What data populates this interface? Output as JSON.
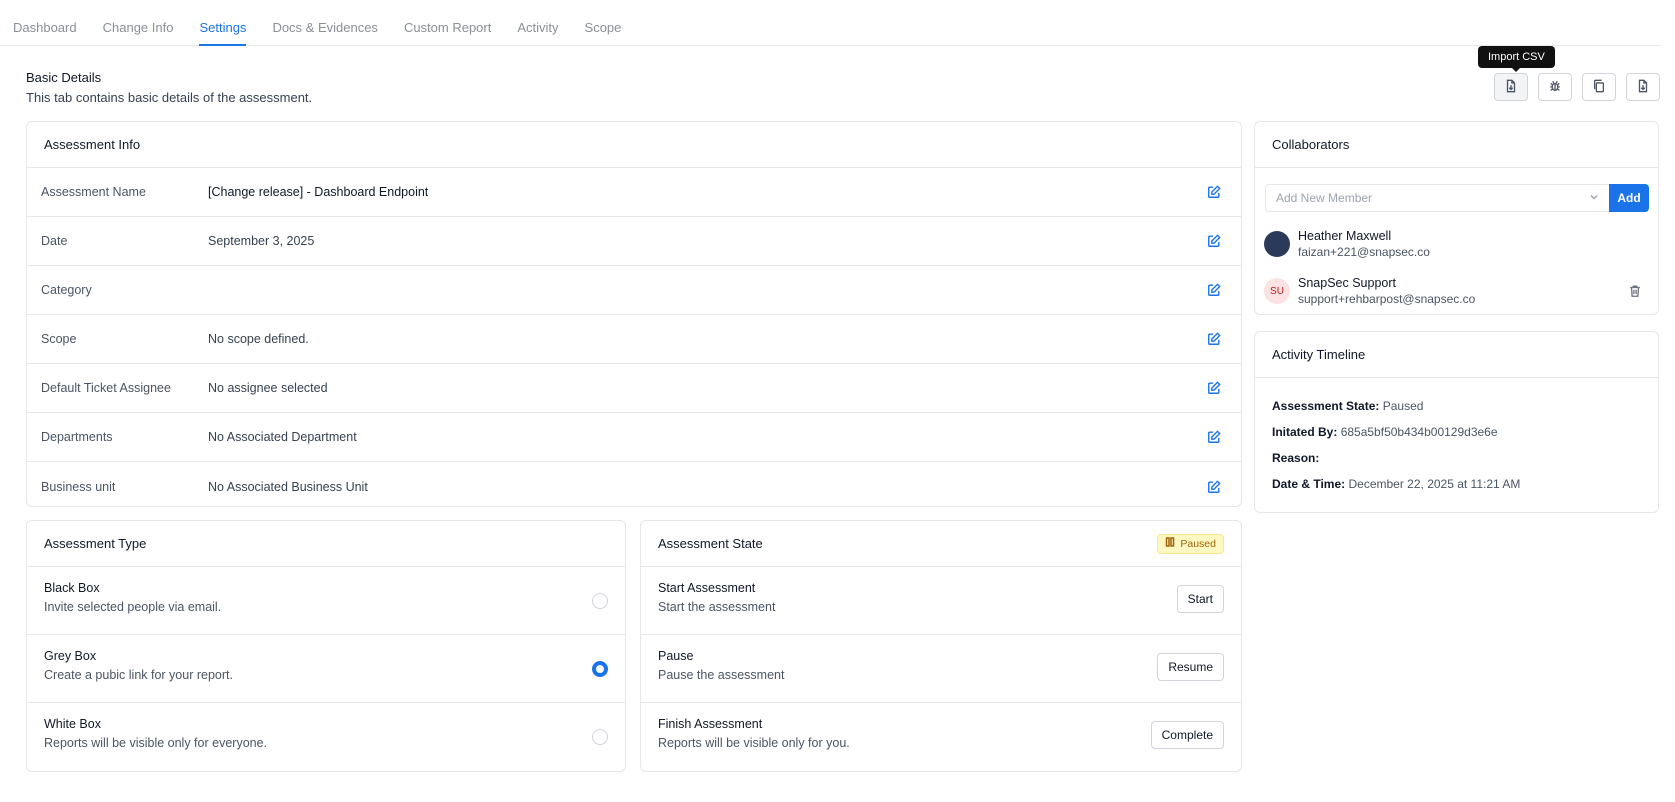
{
  "tabs": [
    {
      "label": "Dashboard",
      "active": false
    },
    {
      "label": "Change Info",
      "active": false
    },
    {
      "label": "Settings",
      "active": true
    },
    {
      "label": "Docs & Evidences",
      "active": false
    },
    {
      "label": "Custom Report",
      "active": false
    },
    {
      "label": "Activity",
      "active": false
    },
    {
      "label": "Scope",
      "active": false
    }
  ],
  "header": {
    "title": "Basic Details",
    "description": "This tab contains basic details of the assessment."
  },
  "tooltip": "Import CSV",
  "toolbar": {
    "icons": [
      "file-import-icon",
      "bug-icon",
      "copy-icon",
      "file-download-icon"
    ]
  },
  "assessment_info": {
    "title": "Assessment Info",
    "rows": [
      {
        "label": "Assessment Name",
        "value": "[Change release] - Dashboard Endpoint"
      },
      {
        "label": "Date",
        "value": "September 3, 2025"
      },
      {
        "label": "Category",
        "value": ""
      },
      {
        "label": "Scope",
        "value": "No scope defined."
      },
      {
        "label": "Default Ticket Assignee",
        "value": "No assignee selected"
      },
      {
        "label": "Departments",
        "value": "No Associated Department"
      },
      {
        "label": "Business unit",
        "value": "No Associated Business Unit"
      }
    ]
  },
  "assessment_type": {
    "title": "Assessment Type",
    "options": [
      {
        "title": "Black Box",
        "desc": "Invite selected people via email.",
        "selected": false
      },
      {
        "title": "Grey Box",
        "desc": "Create a pubic link for your report.",
        "selected": true
      },
      {
        "title": "White Box",
        "desc": "Reports will be visible only for everyone.",
        "selected": false
      }
    ]
  },
  "assessment_state": {
    "title": "Assessment State",
    "badge": "Paused",
    "rows": [
      {
        "title": "Start Assessment",
        "desc": "Start the assessment",
        "button": "Start"
      },
      {
        "title": "Pause",
        "desc": "Pause the assessment",
        "button": "Resume"
      },
      {
        "title": "Finish Assessment",
        "desc": "Reports will be visible only for you.",
        "button": "Complete"
      }
    ]
  },
  "collaborators": {
    "title": "Collaborators",
    "placeholder": "Add New Member",
    "add_label": "Add",
    "members": [
      {
        "name": "Heather Maxwell",
        "email": "faizan+221@snapsec.co",
        "initials": ""
      },
      {
        "name": "SnapSec Support",
        "email": "support+rehbarpost@snapsec.co",
        "initials": "SU"
      }
    ]
  },
  "activity_timeline": {
    "title": "Activity Timeline",
    "state_label": "Assessment State:",
    "state_value": "Paused",
    "initiated_label": "Initated By:",
    "initiated_value": "685a5bf50b434b00129d3e6e",
    "reason_label": "Reason:",
    "reason_value": "",
    "datetime_label": "Date & Time:",
    "datetime_value": "December 22, 2025 at 11:21 AM"
  },
  "colors": {
    "accent": "#1a73e8",
    "badge_bg": "#fef9c3",
    "badge_text": "#a16207"
  }
}
